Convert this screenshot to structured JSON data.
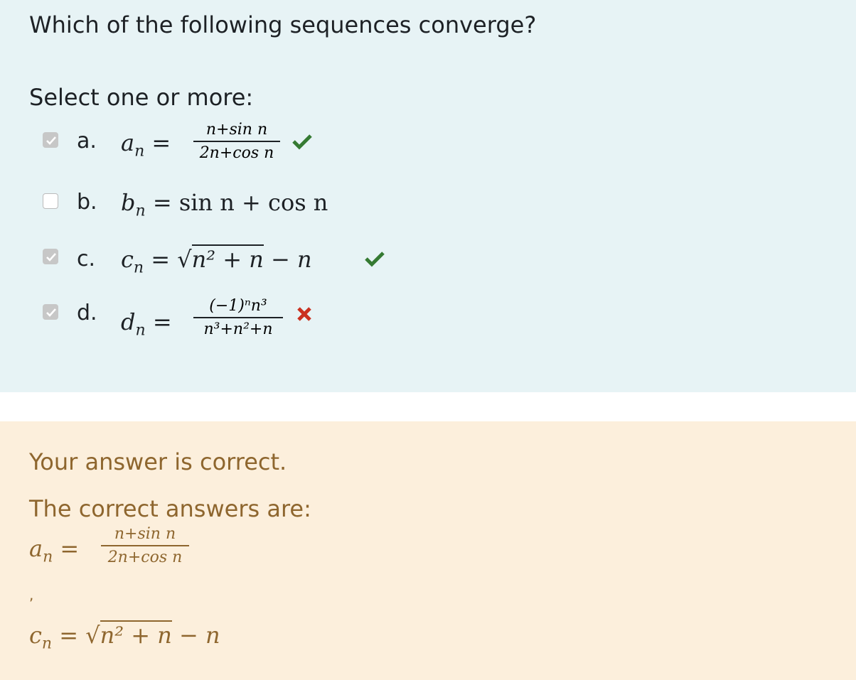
{
  "question": {
    "text": "Which of the following sequences converge?",
    "prompt": "Select one or more:"
  },
  "options": [
    {
      "letter": "a.",
      "checked": true,
      "status": "correct",
      "lhs": "a",
      "sub": "n",
      "num": "n+sin n",
      "den": "2n+cos n"
    },
    {
      "letter": "b.",
      "checked": false,
      "status": "none",
      "lhs": "b",
      "sub": "n",
      "rhs": "= sin n + cos n"
    },
    {
      "letter": "c.",
      "checked": true,
      "status": "correct",
      "lhs": "c",
      "sub": "n",
      "rhs_pre": "=",
      "sqrt": "n² + n",
      "rhs_post": "− n"
    },
    {
      "letter": "d.",
      "checked": true,
      "status": "incorrect",
      "lhs": "d",
      "sub": "n",
      "num": "(−1)ⁿn³",
      "den": "n³+n²+n"
    }
  ],
  "colors": {
    "correct": "#357a32",
    "incorrect": "#ca3120",
    "feedback_text": "#8e662e",
    "question_bg": "#e7f3f5",
    "feedback_bg": "#fcefdc"
  },
  "feedback": {
    "status": "Your answer is correct.",
    "correct_label": "The correct answers are:",
    "answer1": {
      "lhs": "a",
      "sub": "n",
      "num": "n+sin n",
      "den": "2n+cos n"
    },
    "separator": ",",
    "answer2": {
      "lhs": "c",
      "sub": "n",
      "sqrt": "n² + n",
      "rhs_post": "− n"
    }
  }
}
